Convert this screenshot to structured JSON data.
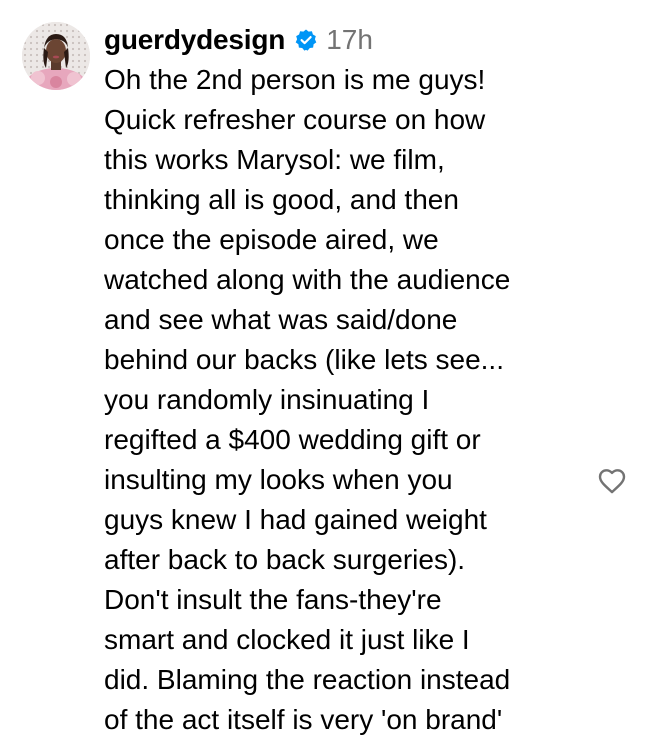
{
  "comment": {
    "username": "guerdydesign",
    "verified_icon": "verified-badge-icon",
    "time": "17h",
    "text_lines": [
      "Oh the 2nd person is me guys!",
      "Quick refresher course on how",
      "this works Marysol: we film,",
      "thinking all is good, and then",
      "once the episode aired, we",
      "watched along with the audience",
      "and see what was said/done",
      "behind our backs (like lets see...",
      "you randomly insinuating I",
      "regifted a $400 wedding gift or",
      "insulting my looks when you",
      "guys knew I had gained weight",
      "after back to back surgeries).",
      "Don't insult the fans-they're",
      "smart and clocked it just like I",
      "did. Blaming the reaction instead",
      "of the act itself is very 'on brand'"
    ],
    "like_icon": "heart-outline-icon"
  },
  "colors": {
    "text": "#000000",
    "muted": "#737373",
    "verified": "#0095f6",
    "icon_stroke": "#737373"
  }
}
